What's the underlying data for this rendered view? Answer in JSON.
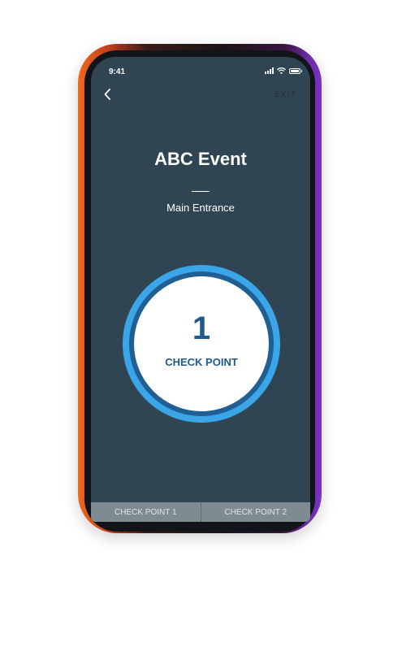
{
  "status_bar": {
    "time": "9:41"
  },
  "nav": {
    "exit_label": "EXIT"
  },
  "event": {
    "title": "ABC Event",
    "location": "Main Entrance"
  },
  "checkpoint": {
    "number": "1",
    "label": "CHECK POINT"
  },
  "tabs": [
    {
      "label": "CHECK POINT 1"
    },
    {
      "label": "CHECK POINT 2"
    }
  ],
  "colors": {
    "screen_bg": "#2f4553",
    "ring_outer": "#3aa6e8",
    "ring_mid": "#1f5f93",
    "checkpoint_text": "#1f5a8c",
    "tabbar_bg": "#7e8b93"
  },
  "icons": [
    "back-chevron-icon",
    "signal-icon",
    "wifi-icon",
    "battery-icon"
  ]
}
